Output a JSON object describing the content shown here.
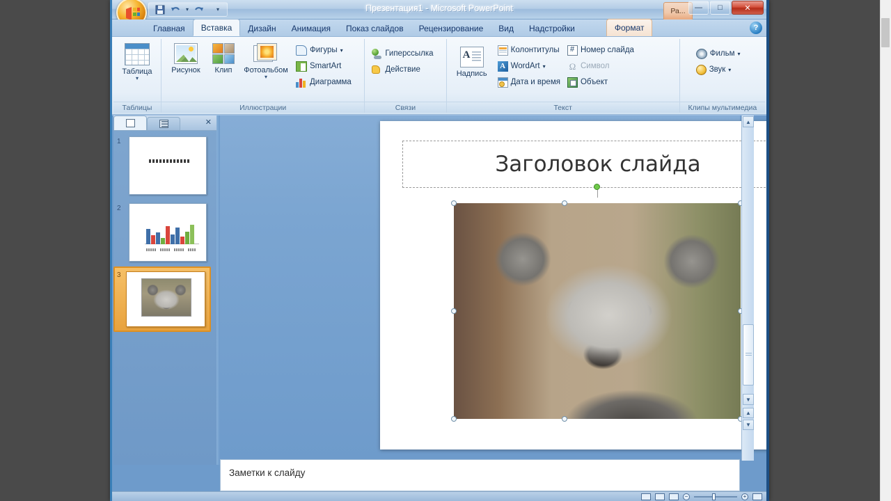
{
  "window": {
    "title": "Презентация1 - Microsoft PowerPoint",
    "contextual_tab_group": "Ра...",
    "minimize": "—",
    "maximize": "□",
    "close": "✕"
  },
  "quick_access": {
    "save": "save-icon",
    "undo": "undo-icon",
    "undo_dropdown": "▾",
    "redo": "redo-icon",
    "customize": "▾"
  },
  "tabs": [
    {
      "label": "Главная",
      "state": "normal"
    },
    {
      "label": "Вставка",
      "state": "active"
    },
    {
      "label": "Дизайн",
      "state": "normal"
    },
    {
      "label": "Анимация",
      "state": "normal"
    },
    {
      "label": "Показ слайдов",
      "state": "normal"
    },
    {
      "label": "Рецензирование",
      "state": "normal"
    },
    {
      "label": "Вид",
      "state": "normal"
    },
    {
      "label": "Надстройки",
      "state": "normal"
    },
    {
      "label": "Формат",
      "state": "contextual"
    }
  ],
  "help_button": "?",
  "ribbon": {
    "groups": [
      {
        "title": "Таблицы",
        "big_buttons": [
          {
            "label": "Таблица",
            "icon": "table-icon",
            "dropdown": "▾"
          }
        ],
        "small_buttons": []
      },
      {
        "title": "Иллюстрации",
        "big_buttons": [
          {
            "label": "Рисунок",
            "icon": "picture-icon",
            "dropdown": ""
          },
          {
            "label": "Клип",
            "icon": "clipart-icon",
            "dropdown": ""
          },
          {
            "label": "Фотоальбом",
            "icon": "photoalbum-icon",
            "dropdown": "▾"
          }
        ],
        "small_buttons": [
          {
            "label": "Фигуры",
            "icon": "shapes-icon",
            "dropdown": "▾",
            "disabled": false
          },
          {
            "label": "SmartArt",
            "icon": "smartart-icon",
            "dropdown": "",
            "disabled": false
          },
          {
            "label": "Диаграмма",
            "icon": "chart-icon",
            "dropdown": "",
            "disabled": false
          }
        ]
      },
      {
        "title": "Связи",
        "big_buttons": [],
        "small_buttons": [
          {
            "label": "Гиперссылка",
            "icon": "hyperlink-icon",
            "dropdown": "",
            "disabled": false
          },
          {
            "label": "Действие",
            "icon": "action-icon",
            "dropdown": "",
            "disabled": false
          }
        ]
      },
      {
        "title": "Текст",
        "big_buttons": [
          {
            "label": "Надпись",
            "icon": "textbox-icon",
            "dropdown": ""
          }
        ],
        "small_buttons": [
          {
            "label": "Колонтитулы",
            "icon": "headerfooter-icon",
            "dropdown": "",
            "disabled": false
          },
          {
            "label": "WordArt",
            "icon": "wordart-icon",
            "dropdown": "▾",
            "disabled": false
          },
          {
            "label": "Дата и время",
            "icon": "datetime-icon",
            "dropdown": "",
            "disabled": false
          },
          {
            "label": "Номер слайда",
            "icon": "slidenumber-icon",
            "dropdown": "",
            "disabled": false
          },
          {
            "label": "Символ",
            "icon": "symbol-icon",
            "dropdown": "",
            "disabled": true
          },
          {
            "label": "Объект",
            "icon": "object-icon",
            "dropdown": "",
            "disabled": false
          }
        ]
      },
      {
        "title": "Клипы мультимедиа",
        "big_buttons": [],
        "small_buttons": [
          {
            "label": "Фильм",
            "icon": "movie-icon",
            "dropdown": "▾",
            "disabled": false
          },
          {
            "label": "Звук",
            "icon": "sound-icon",
            "dropdown": "▾",
            "disabled": false
          }
        ]
      }
    ]
  },
  "slide_pane": {
    "tab_slides": "slides-tab-icon",
    "tab_outline": "outline-tab-icon",
    "close": "✕",
    "thumbnails": [
      {
        "number": "1",
        "type": "title",
        "selected": false
      },
      {
        "number": "2",
        "type": "chart",
        "selected": false
      },
      {
        "number": "3",
        "type": "picture",
        "selected": true
      }
    ]
  },
  "slide": {
    "title_placeholder_text": "Заголовок слайда",
    "picture_alt": "koala-photo"
  },
  "notes": {
    "placeholder_text": "Заметки к слайду"
  },
  "scrollbar": {
    "up_arrow": "▲",
    "down_arrow": "▼",
    "prev_slide": "▲",
    "next_slide": "▼"
  },
  "status_bar": {
    "normal_view": "normal-view-icon",
    "sorter_view": "sorter-view-icon",
    "show_view": "slideshow-view-icon",
    "zoom_out": "−",
    "zoom_in": "+",
    "fit_window": "fit-icon"
  },
  "colors": {
    "accent": "#1d4f84",
    "selected_thumb": "#e8a23d",
    "contextual_tab": "#f0c8ab",
    "click_halo": "#0f6fd4",
    "rotation_handle": "#6fc94a"
  }
}
